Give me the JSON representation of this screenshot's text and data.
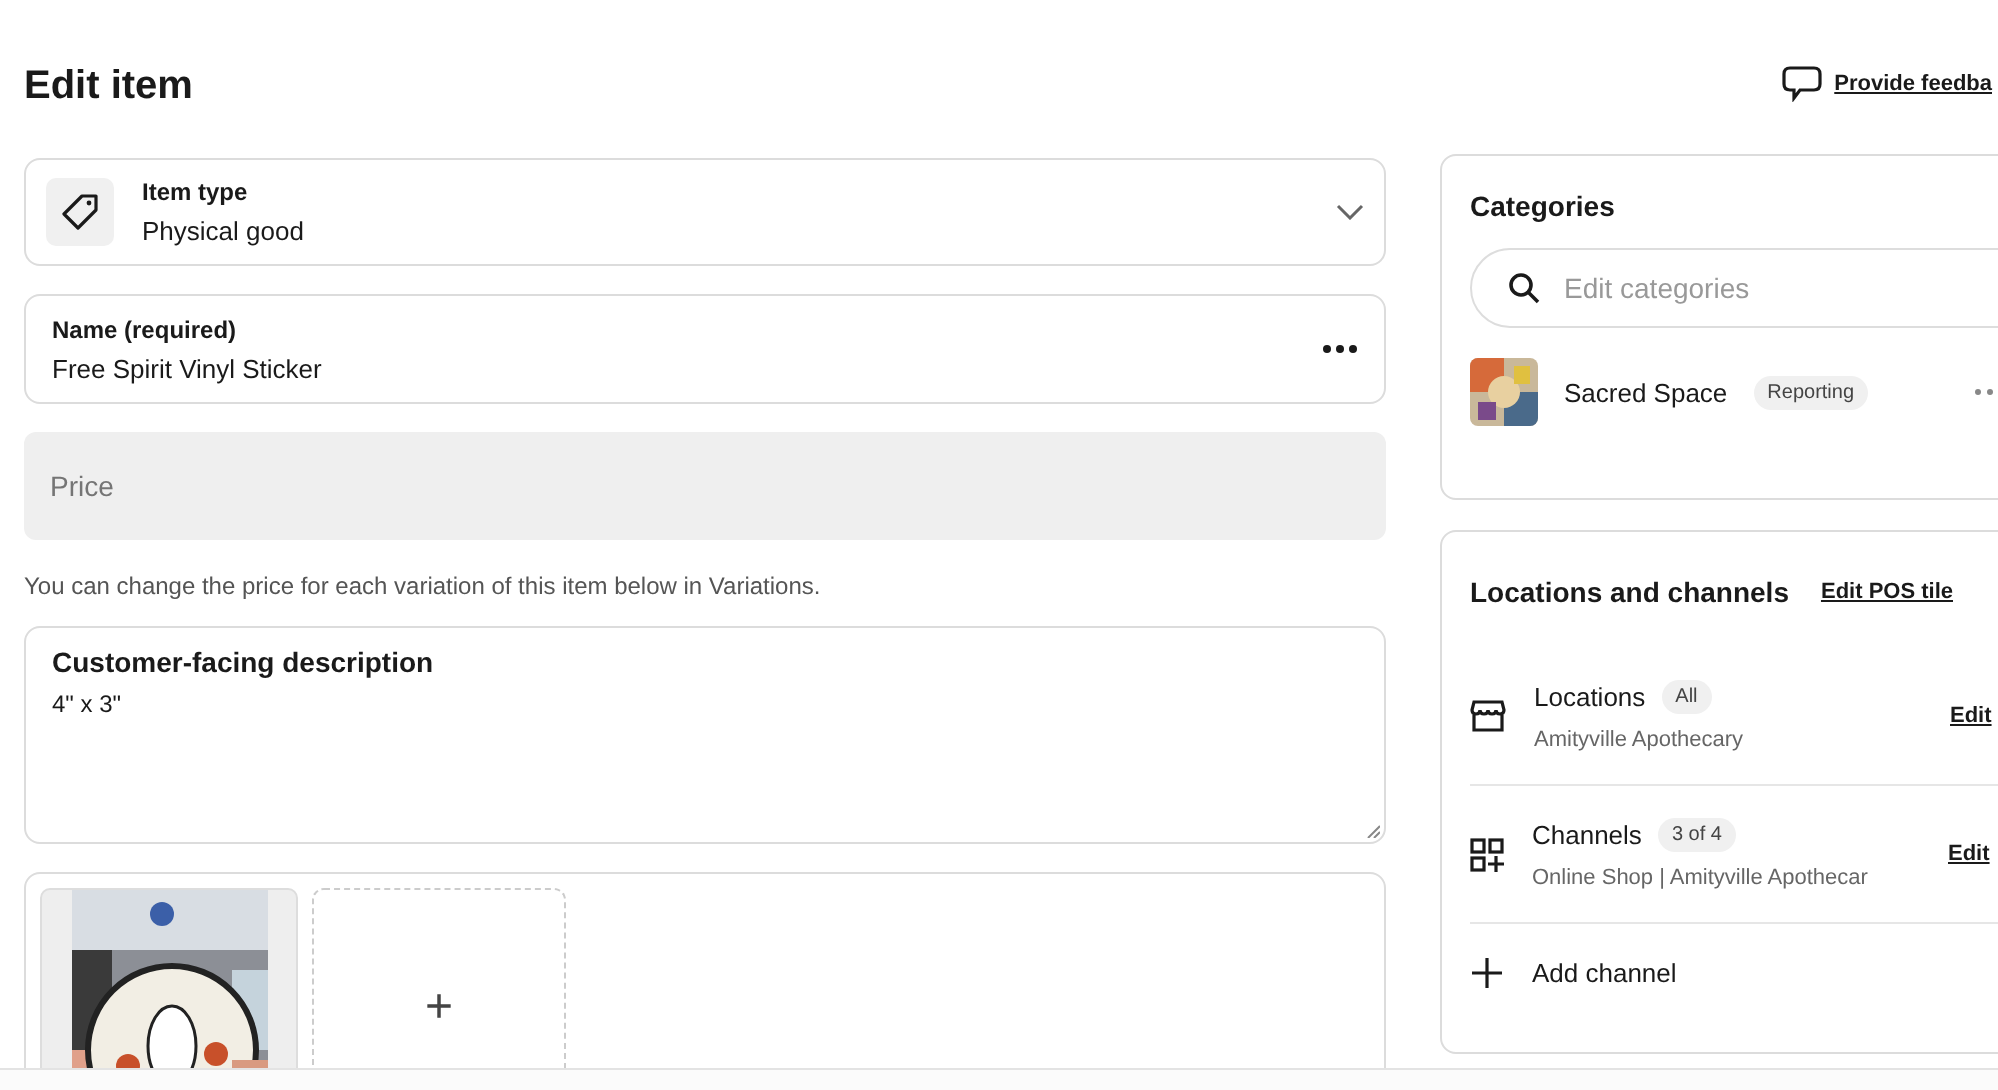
{
  "page": {
    "title": "Edit item",
    "feedback_link": "Provide feedba"
  },
  "item_type": {
    "label": "Item type",
    "value": "Physical good"
  },
  "name_field": {
    "label": "Name (required)",
    "value": "Free Spirit Vinyl Sticker"
  },
  "price_field": {
    "placeholder": "Price",
    "disabled": true
  },
  "price_help": "You can change the price for each variation of this item below in Variations.",
  "description": {
    "label": "Customer-facing description",
    "value": "4\" x 3\""
  },
  "images": [
    {
      "kind": "picture"
    },
    {
      "kind": "add",
      "label": "+"
    }
  ],
  "categories": {
    "title": "Categories",
    "search_placeholder": "Edit categories",
    "items": [
      {
        "name": "Sacred Space",
        "tag": "Reporting"
      }
    ]
  },
  "locations_channels": {
    "title": "Locations and channels",
    "action": "Edit POS tile",
    "rows": [
      {
        "kind": "locations",
        "title": "Locations",
        "badge": "All",
        "detail": "Amityville Apothecary",
        "action": "Edit"
      },
      {
        "kind": "channels",
        "title": "Channels",
        "badge": "3 of 4",
        "detail": "Online Shop | Amityville Apothecar",
        "action": "Edit"
      },
      {
        "kind": "add",
        "title": "Add channel"
      }
    ]
  }
}
